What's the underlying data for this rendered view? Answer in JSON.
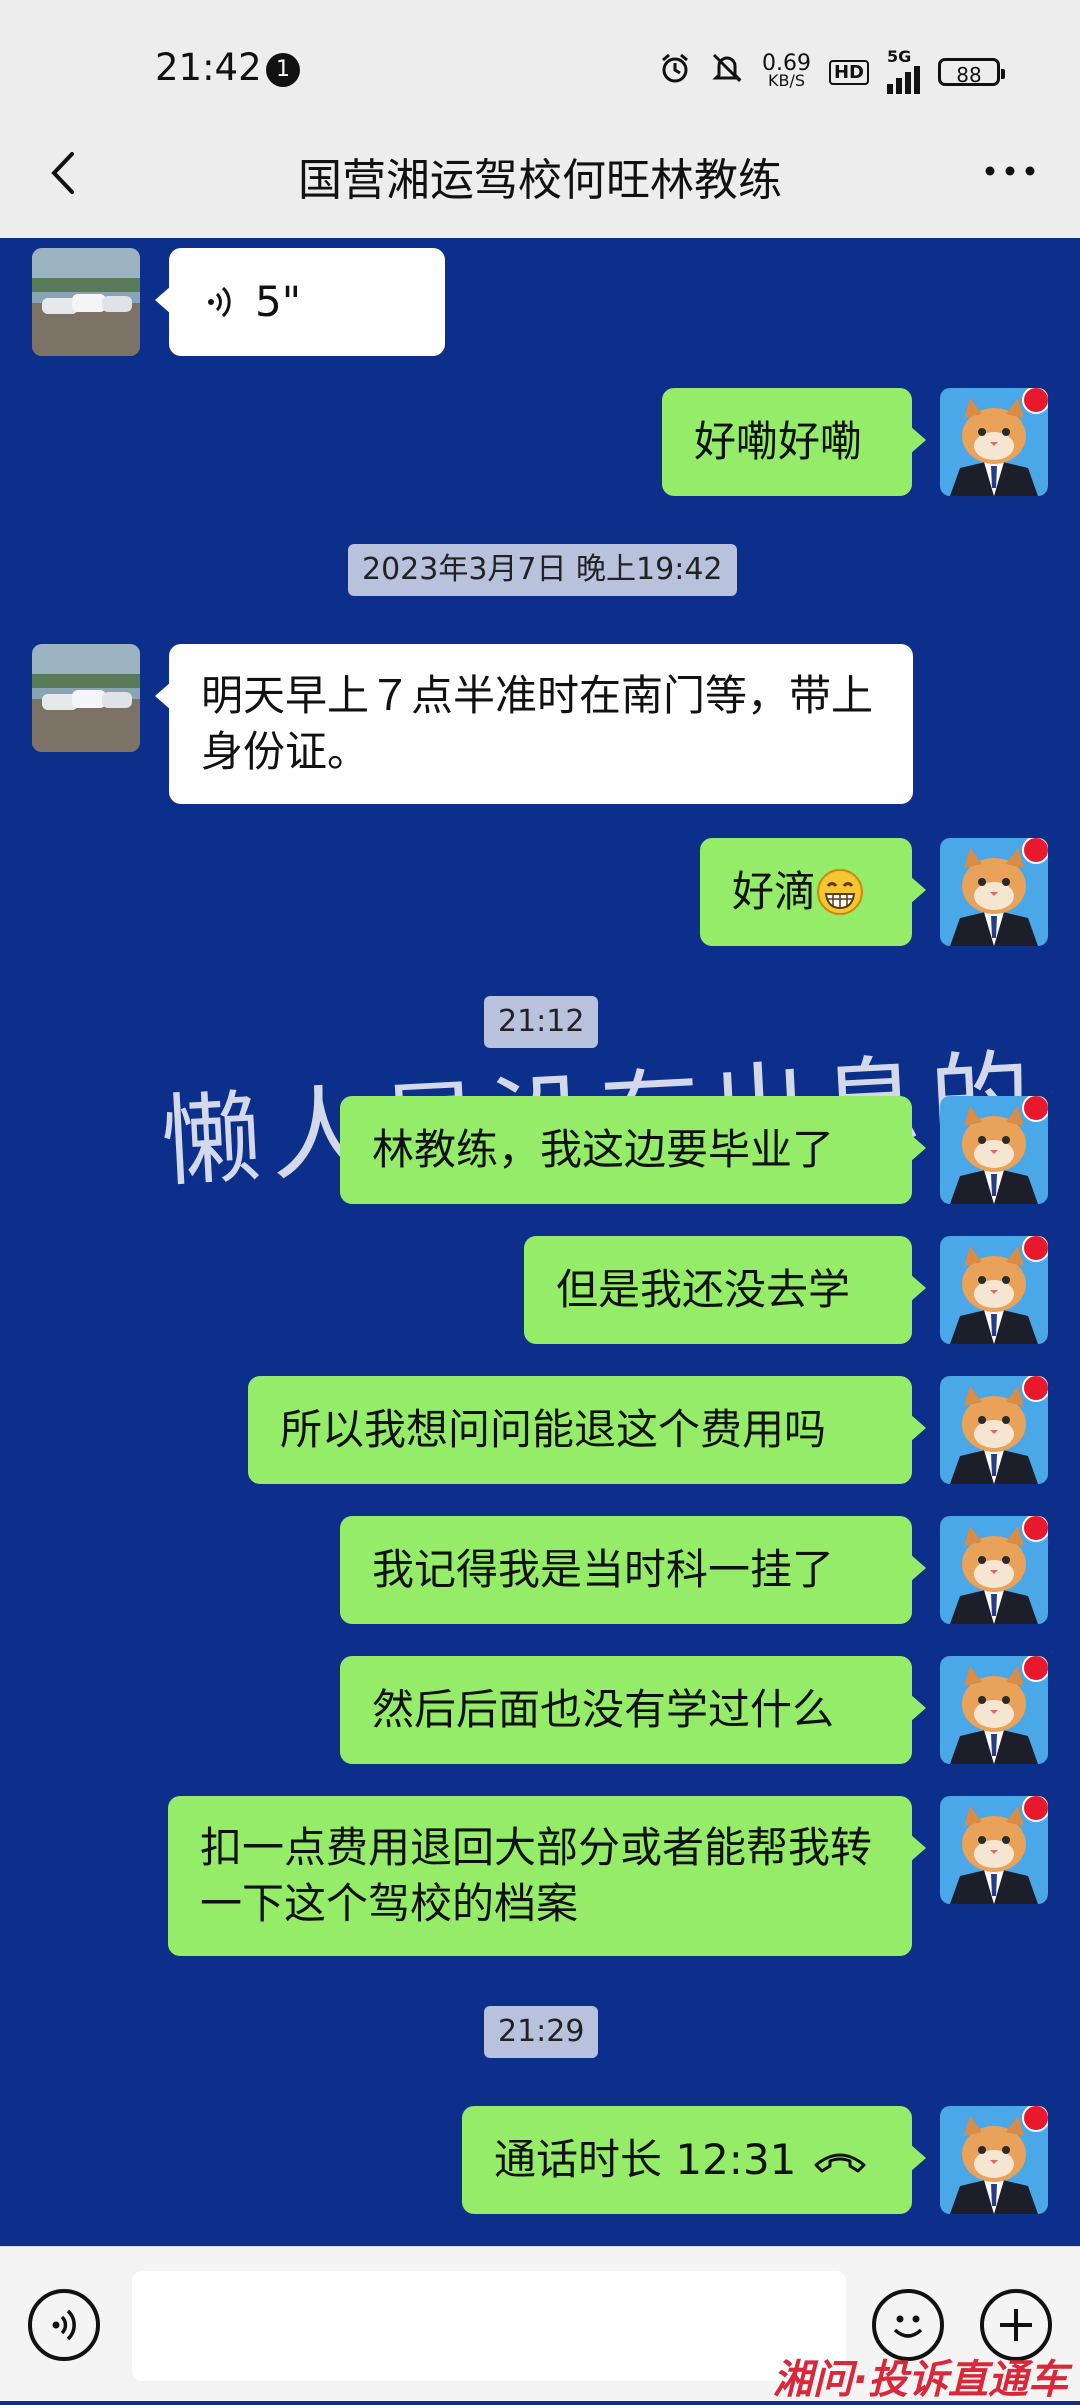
{
  "status_bar": {
    "time": "21:42",
    "notification_count": "1",
    "net_speed_value": "0.69",
    "net_speed_unit": "KB/S",
    "hd_label": "HD",
    "network": "5G",
    "battery": "88"
  },
  "header": {
    "title": "国营湘运驾校何旺林教练"
  },
  "messages": {
    "voice_duration": "5\"",
    "m1": "好嘞好嘞",
    "ts1": "2023年3月7日 晚上19:42",
    "m2": "明天早上７点半准时在南门等，带上身份证。",
    "m3": "好滴",
    "ts2": "21:12",
    "m4": "林教练，我这边要毕业了",
    "m5": "但是我还没去学",
    "m6": "所以我想问问能退这个费用吗",
    "m7": "我记得我是当时科一挂了",
    "m8": "然后后面也没有学过什么",
    "m9": "扣一点费用退回大部分或者能帮我转一下这个驾校的档案",
    "ts3": "21:29",
    "m10": "通话时长 12:31"
  },
  "watermark": "懒人是没有出息的",
  "footer": {
    "input_value": "",
    "site_logo": "湘问·投诉直通车"
  },
  "colors": {
    "chat_background": "#0d2f8c",
    "bubble_sent": "#95ec69",
    "bubble_received": "#ffffff",
    "unread_dot": "#e8192c"
  },
  "icons": [
    "back-arrow-icon",
    "more-icon",
    "voice-wave-icon",
    "grin-emoji-icon",
    "phone-hangup-icon",
    "voice-input-icon",
    "emoji-icon",
    "plus-icon",
    "alarm-icon",
    "mute-icon"
  ]
}
